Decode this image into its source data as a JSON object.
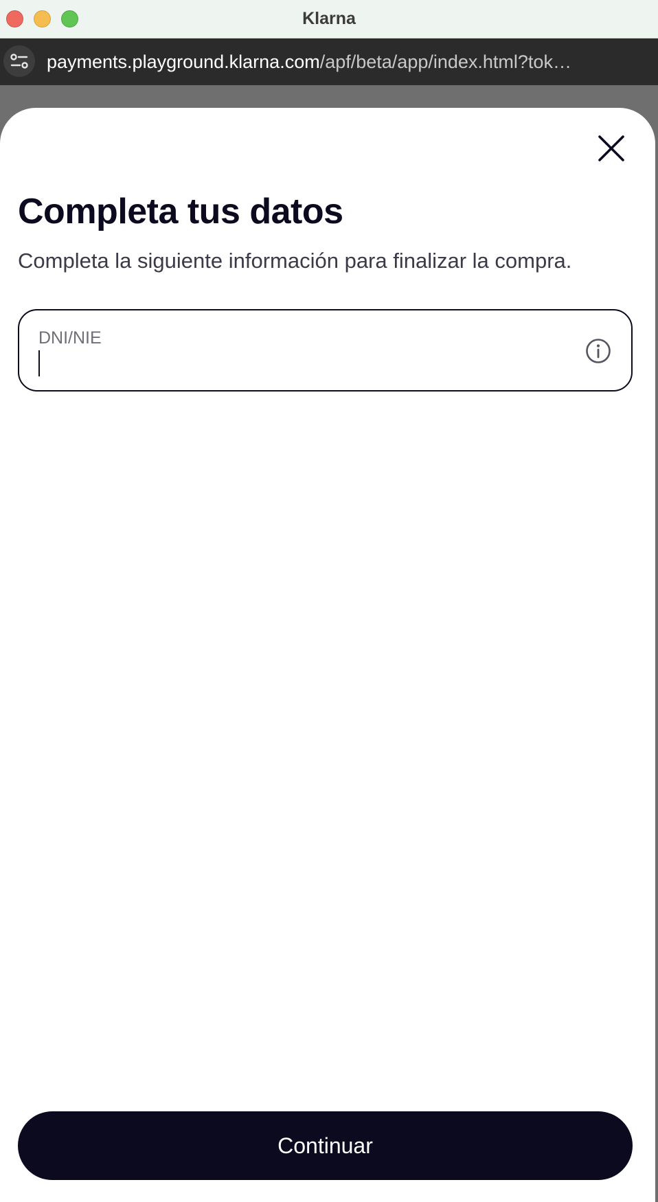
{
  "window": {
    "title": "Klarna"
  },
  "browser": {
    "url_host": "payments.playground.klarna.com",
    "url_path": "/apf/beta/app/index.html?tok…",
    "site_settings_icon": "tune-icon"
  },
  "sheet": {
    "close_icon": "close-icon",
    "heading": "Completa tus datos",
    "description": "Completa la siguiente información para finalizar la compra.",
    "dni_field": {
      "label": "DNI/NIE",
      "value": "",
      "info_icon": "info-icon"
    },
    "continue_label": "Continuar"
  },
  "colors": {
    "primary": "#0b0a1f",
    "background": "#ffffff",
    "backdrop": "#6f6f6f",
    "titlebar": "#eef4f0",
    "urlbar": "#2b2b2b"
  }
}
